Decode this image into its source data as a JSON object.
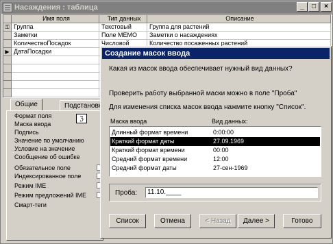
{
  "window": {
    "title": "Насаждения : таблица"
  },
  "grid": {
    "headers": [
      "Имя поля",
      "Тип данных",
      "Описание"
    ],
    "rows": [
      {
        "marker": "⚿",
        "name": "Группа",
        "type": "Текстовый",
        "desc": "Группа для растений"
      },
      {
        "marker": "",
        "name": "Заметки",
        "type": "Поле MEMO",
        "desc": "Заметки о насаждениях"
      },
      {
        "marker": "",
        "name": "КоличествоПосадок",
        "type": "Числовой",
        "desc": "Количество посаженных растений"
      },
      {
        "marker": "▶",
        "name": "ДатаПосадки",
        "type": "",
        "desc": ""
      }
    ]
  },
  "lower": {
    "tabs": [
      "Общие",
      "Подстановка"
    ],
    "properties": [
      "Формат поля",
      "Маска ввода",
      "Подпись",
      "Значение по умолчанию",
      "Условие на значение",
      "Сообщение об ошибке",
      "Обязательное поле",
      "Индексированное поле",
      "Режим IME",
      "Режим предложений IME",
      "Смарт-теги"
    ]
  },
  "dialog": {
    "title": "Создание масок ввода",
    "question": "Какая из масок ввода обеспечивает нужный вид данных?",
    "hint1": "Проверить работу выбранной маски можно в поле \"Проба\"",
    "hint2": "Для изменения списка масок ввода нажмите кнопку \"Список\".",
    "col_mask": "Маска ввода",
    "col_view": "Вид данных:",
    "masks": [
      {
        "name": "Длинный формат времени",
        "view": "0:00:00"
      },
      {
        "name": "Краткий формат даты",
        "view": "27.09.1969",
        "selected": true
      },
      {
        "name": "Краткий формат времени",
        "view": "00:00"
      },
      {
        "name": "Средний формат времени",
        "view": "12:00"
      },
      {
        "name": "Средний формат даты",
        "view": "27-сен-1969"
      }
    ],
    "probe_label": "Проба:",
    "probe_value": "11.10.____",
    "buttons": {
      "list": "Список",
      "cancel": "Отмена",
      "back": "< Назад",
      "next": "Далее >",
      "finish": "Готово"
    }
  }
}
